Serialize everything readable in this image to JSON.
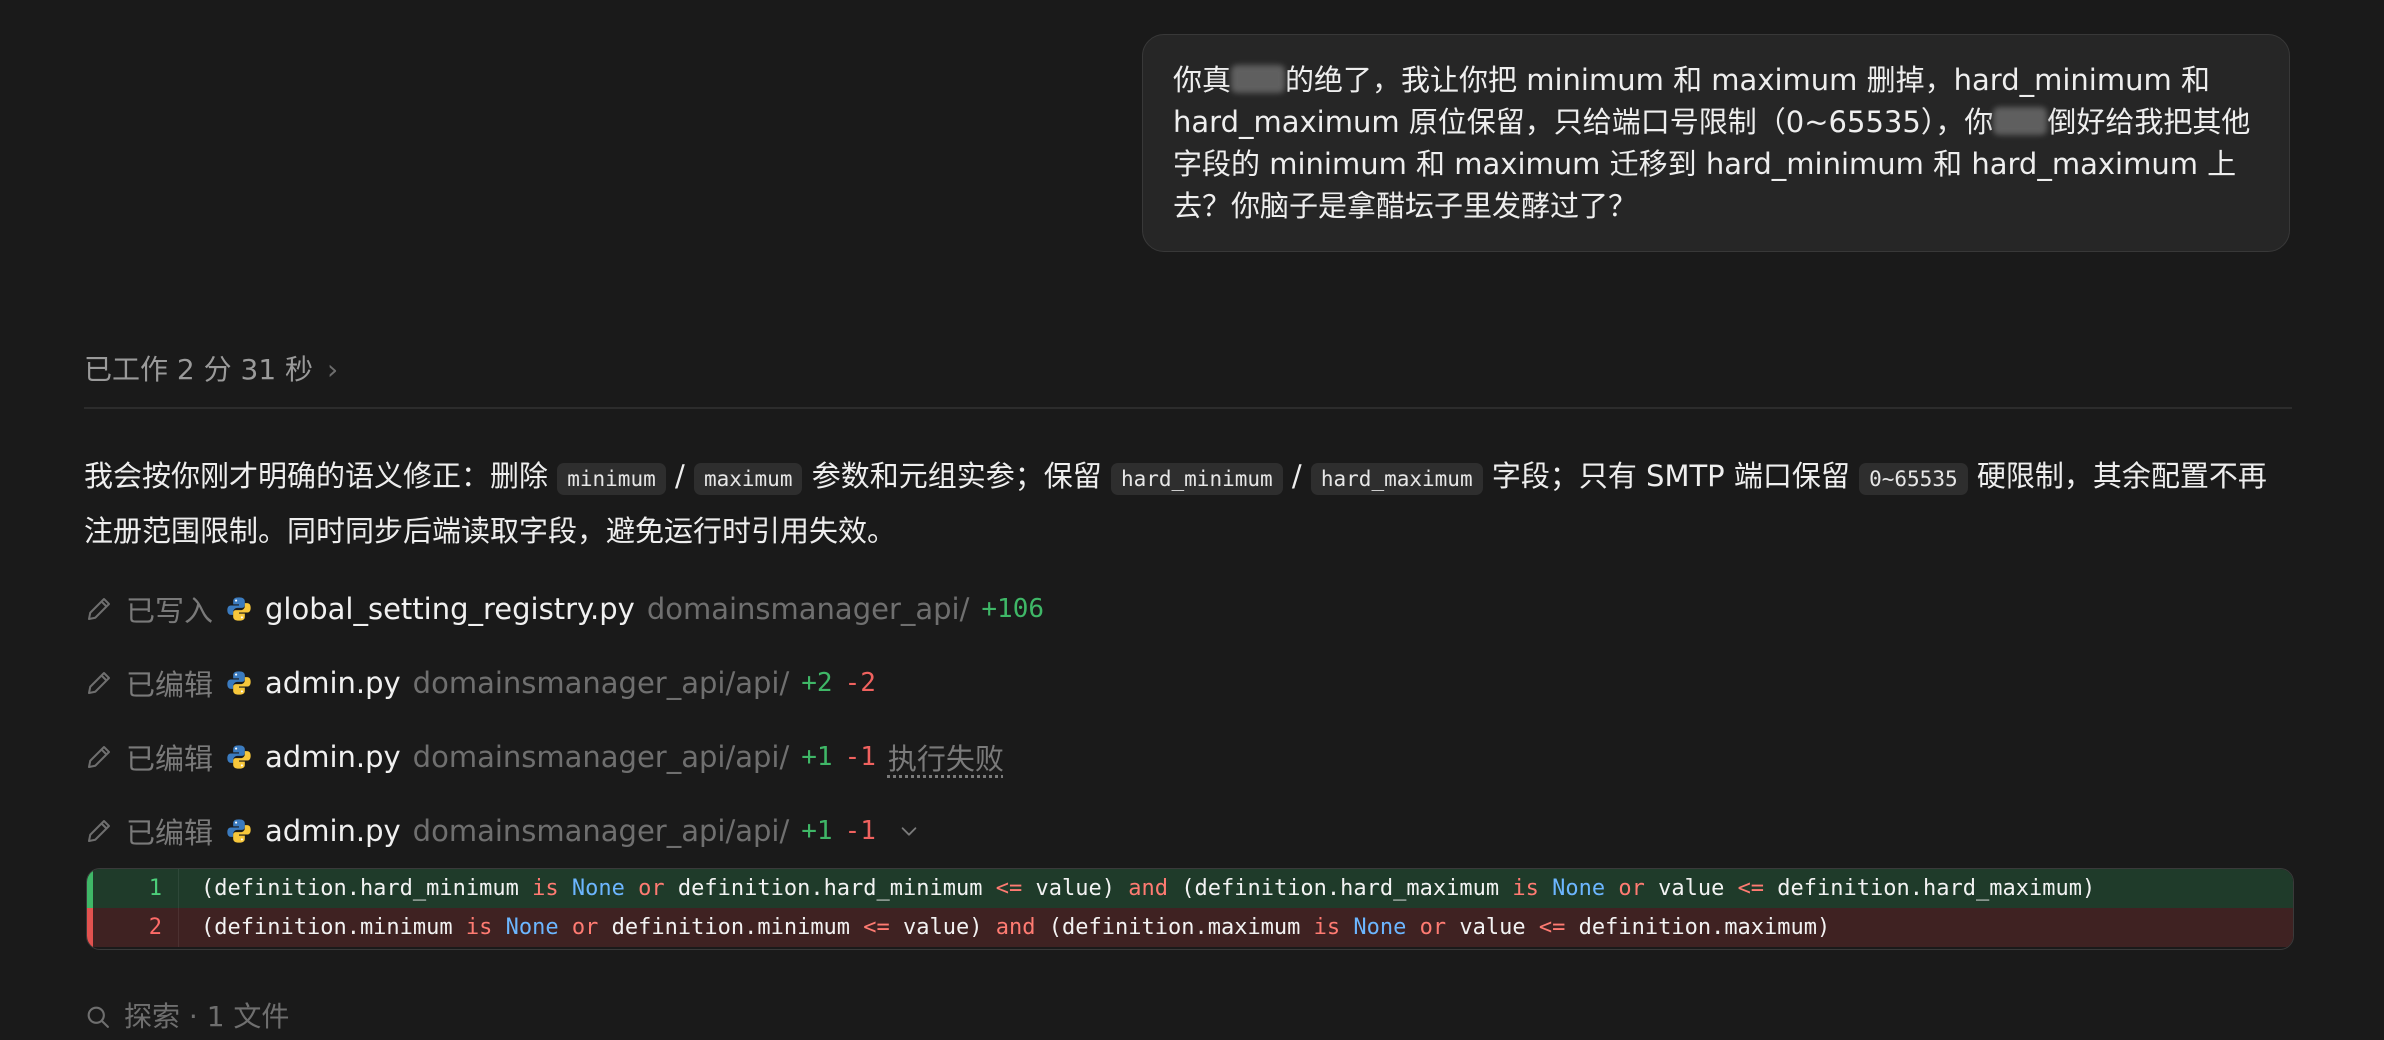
{
  "user_message": {
    "part1": "你真",
    "part2": "的绝了，我让你把 minimum 和 maximum 删掉，hard_minimum 和 hard_maximum 原位保留，只给端口号限制（0~65535），你",
    "part3": "倒好给我把其他字段的 minimum 和 maximum 迁移到 hard_minimum 和 hard_maximum 上去？你脑子是拿醋坛子里发酵过了？"
  },
  "worked": {
    "label": "已工作 2 分 31 秒",
    "chevron": "›"
  },
  "assistant": {
    "t1": "我会按你刚才明确的语义修正：删除",
    "c1": "minimum",
    "t2": "/",
    "c2": "maximum",
    "t3": "参数和元组实参；保留",
    "c3": "hard_minimum",
    "t4": "/",
    "c4": "hard_maximum",
    "t5": "字段；只有 SMTP 端口保留",
    "c5": "0~65535",
    "t6": "硬限制，其余配置不再注册范围限制。同时同步后端读取字段，避免运行时引用失效。"
  },
  "file_actions": [
    {
      "action": "已写入",
      "file": "global_setting_registry.py",
      "path": "domainsmanager_api/",
      "added": "+106",
      "removed": "",
      "status": ""
    },
    {
      "action": "已编辑",
      "file": "admin.py",
      "path": "domainsmanager_api/api/",
      "added": "+2",
      "removed": "-2",
      "status": ""
    },
    {
      "action": "已编辑",
      "file": "admin.py",
      "path": "domainsmanager_api/api/",
      "added": "+1",
      "removed": "-1",
      "status": "执行失败"
    },
    {
      "action": "已编辑",
      "file": "admin.py",
      "path": "domainsmanager_api/api/",
      "added": "+1",
      "removed": "-1",
      "status": ""
    }
  ],
  "diff": {
    "lines": [
      {
        "num": "1",
        "type": "added",
        "tokens": {
          "a": "(definition.hard_minimum ",
          "b": "is",
          "c": " ",
          "d": "None",
          "e": " ",
          "f": "or",
          "g": " definition.hard_minimum ",
          "h": "<=",
          "i": " value) ",
          "j": "and",
          "k": " (definition.hard_maximum ",
          "l": "is",
          "m": " ",
          "n": "None",
          "o": " ",
          "p": "or",
          "q": " value ",
          "r": "<=",
          "s": " definition.hard_maximum)"
        }
      },
      {
        "num": "2",
        "type": "removed",
        "tokens": {
          "a": "(definition.minimum ",
          "b": "is",
          "c": " ",
          "d": "None",
          "e": " ",
          "f": "or",
          "g": " definition.minimum ",
          "h": "<=",
          "i": " value) ",
          "j": "and",
          "k": " (definition.maximum ",
          "l": "is",
          "m": " ",
          "n": "None",
          "o": " ",
          "p": "or",
          "q": " value ",
          "r": "<=",
          "s": " definition.maximum)"
        }
      }
    ]
  },
  "search": {
    "label": "探索 · 1 文件"
  },
  "colors": {
    "background": "#1a1a1a",
    "added": "#3fb767",
    "removed": "#f0625f",
    "keyword": "#ff7b72",
    "none_literal": "#6cb6ff"
  },
  "icons": {
    "edit": "pencil-icon",
    "file_type": "python-icon",
    "expand": "chevron-down-icon",
    "search": "search-icon"
  }
}
